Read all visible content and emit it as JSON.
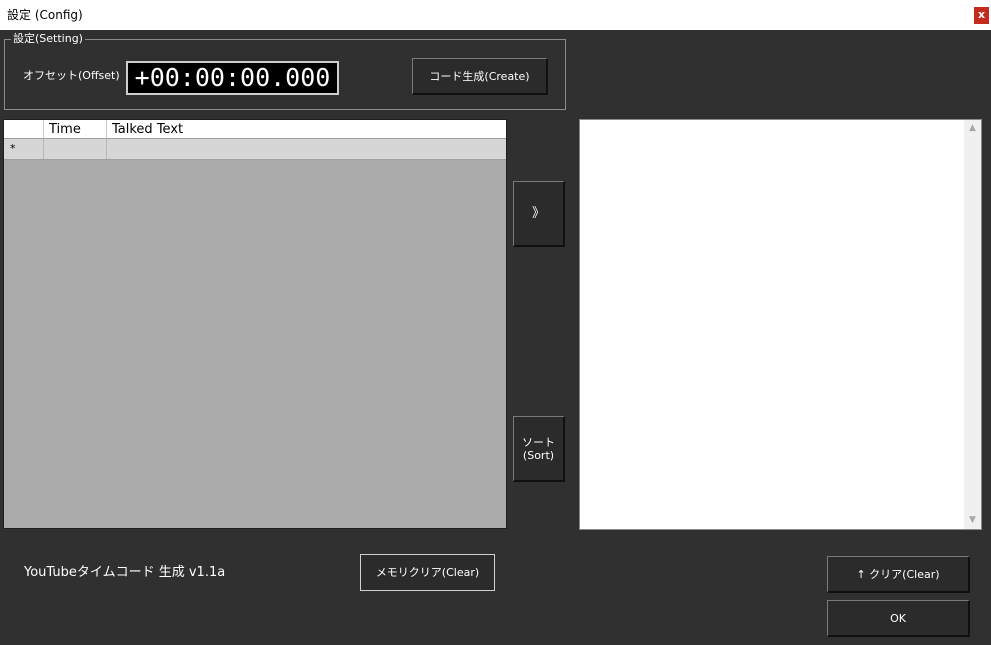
{
  "window": {
    "title": "設定 (Config)",
    "close_label": "x"
  },
  "setting_group": {
    "legend": "設定(Setting)",
    "offset_label": "オフセット(Offset)",
    "offset_value": "+00:00:00.000",
    "create_button": "コード生成(Create)"
  },
  "grid": {
    "columns": [
      "",
      "Time",
      "Talked Text"
    ],
    "new_row_marker": "*"
  },
  "side_buttons": {
    "move_label": "》",
    "sort_label_line1": "ソート",
    "sort_label_line2": "(Sort)"
  },
  "footer": {
    "app_label": "YouTubeタイムコード 生成  v1.1a",
    "memory_clear_button": "メモリクリア(Clear)",
    "clear_button": "↑ クリア(Clear)",
    "ok_button": "OK"
  },
  "textarea": {
    "value": ""
  }
}
